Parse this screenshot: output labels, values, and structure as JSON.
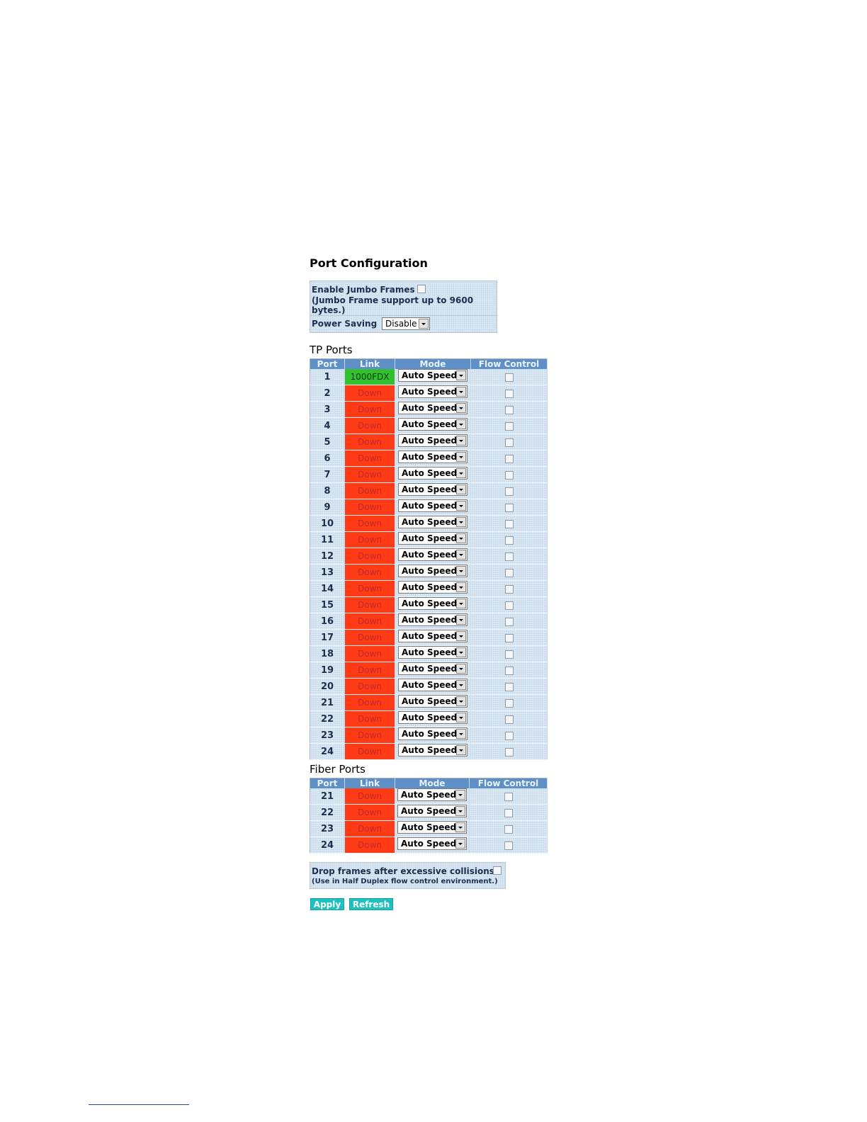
{
  "page": {
    "title": "Port Configuration"
  },
  "jumbo": {
    "label": "Enable Jumbo Frames",
    "note": "(Jumbo Frame support up to 9600 bytes.)",
    "checked": false
  },
  "power_saving": {
    "label": "Power Saving",
    "value": "Disable"
  },
  "tp_ports": {
    "title": "TP Ports",
    "columns": [
      "Port",
      "Link",
      "Mode",
      "Flow Control"
    ],
    "rows": [
      {
        "port": "1",
        "link": "1000FDX",
        "mode": "Auto Speed",
        "flow_control": false
      },
      {
        "port": "2",
        "link": "Down",
        "mode": "Auto Speed",
        "flow_control": false
      },
      {
        "port": "3",
        "link": "Down",
        "mode": "Auto Speed",
        "flow_control": false
      },
      {
        "port": "4",
        "link": "Down",
        "mode": "Auto Speed",
        "flow_control": false
      },
      {
        "port": "5",
        "link": "Down",
        "mode": "Auto Speed",
        "flow_control": false
      },
      {
        "port": "6",
        "link": "Down",
        "mode": "Auto Speed",
        "flow_control": false
      },
      {
        "port": "7",
        "link": "Down",
        "mode": "Auto Speed",
        "flow_control": false
      },
      {
        "port": "8",
        "link": "Down",
        "mode": "Auto Speed",
        "flow_control": false
      },
      {
        "port": "9",
        "link": "Down",
        "mode": "Auto Speed",
        "flow_control": false
      },
      {
        "port": "10",
        "link": "Down",
        "mode": "Auto Speed",
        "flow_control": false
      },
      {
        "port": "11",
        "link": "Down",
        "mode": "Auto Speed",
        "flow_control": false
      },
      {
        "port": "12",
        "link": "Down",
        "mode": "Auto Speed",
        "flow_control": false
      },
      {
        "port": "13",
        "link": "Down",
        "mode": "Auto Speed",
        "flow_control": false
      },
      {
        "port": "14",
        "link": "Down",
        "mode": "Auto Speed",
        "flow_control": false
      },
      {
        "port": "15",
        "link": "Down",
        "mode": "Auto Speed",
        "flow_control": false
      },
      {
        "port": "16",
        "link": "Down",
        "mode": "Auto Speed",
        "flow_control": false
      },
      {
        "port": "17",
        "link": "Down",
        "mode": "Auto Speed",
        "flow_control": false
      },
      {
        "port": "18",
        "link": "Down",
        "mode": "Auto Speed",
        "flow_control": false
      },
      {
        "port": "19",
        "link": "Down",
        "mode": "Auto Speed",
        "flow_control": false
      },
      {
        "port": "20",
        "link": "Down",
        "mode": "Auto Speed",
        "flow_control": false
      },
      {
        "port": "21",
        "link": "Down",
        "mode": "Auto Speed",
        "flow_control": false
      },
      {
        "port": "22",
        "link": "Down",
        "mode": "Auto Speed",
        "flow_control": false
      },
      {
        "port": "23",
        "link": "Down",
        "mode": "Auto Speed",
        "flow_control": false
      },
      {
        "port": "24",
        "link": "Down",
        "mode": "Auto Speed",
        "flow_control": false
      }
    ]
  },
  "fiber_ports": {
    "title": "Fiber Ports",
    "columns": [
      "Port",
      "Link",
      "Mode",
      "Flow Control"
    ],
    "rows": [
      {
        "port": "21",
        "link": "Down",
        "mode": "Auto Speed",
        "flow_control": false
      },
      {
        "port": "22",
        "link": "Down",
        "mode": "Auto Speed",
        "flow_control": false
      },
      {
        "port": "23",
        "link": "Down",
        "mode": "Auto Speed",
        "flow_control": false
      },
      {
        "port": "24",
        "link": "Down",
        "mode": "Auto Speed",
        "flow_control": false
      }
    ]
  },
  "drop_frames": {
    "label": "Drop frames after excessive collisions",
    "note": "(Use in Half Duplex flow control environment.)",
    "checked": false
  },
  "buttons": {
    "apply": "Apply",
    "refresh": "Refresh"
  },
  "colors": {
    "link_up": "#33c02f",
    "link_down": "#ff3b16",
    "header_bg": "#5f8fc7",
    "button_bg": "#1fc0c0",
    "panel_bg": "#dbeaf6"
  }
}
